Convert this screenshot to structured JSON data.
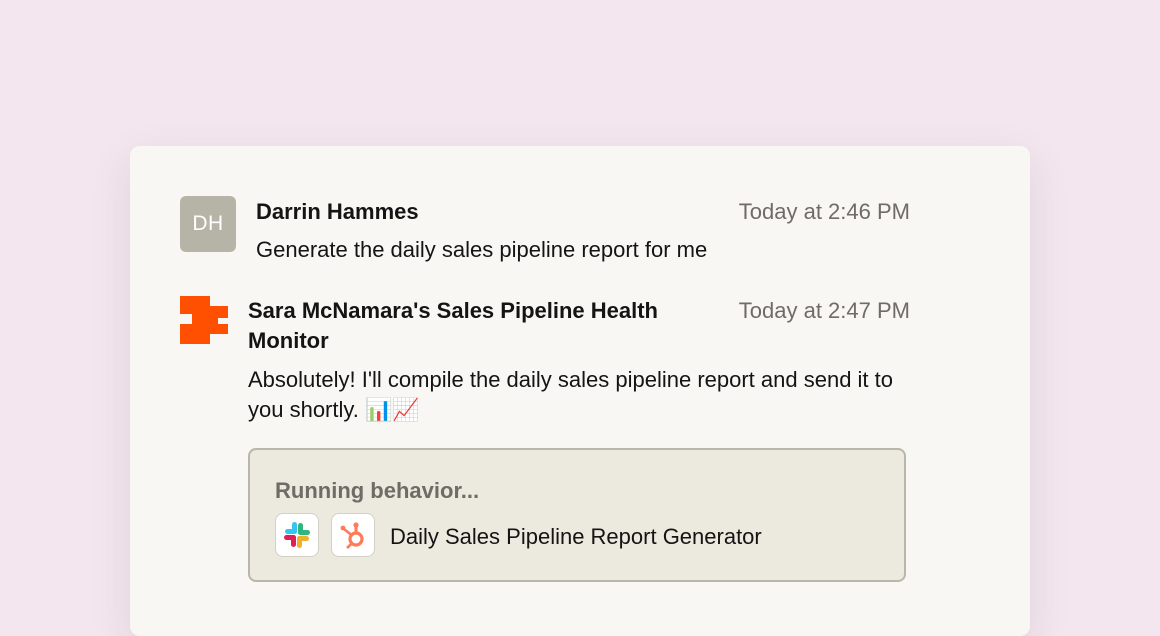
{
  "messages": [
    {
      "avatar_initials": "DH",
      "author": "Darrin Hammes",
      "timestamp": "Today at 2:46 PM",
      "text": "Generate the daily sales pipeline report for me"
    },
    {
      "avatar_icon": "zapier-logo-icon",
      "author": "Sara McNamara's Sales Pipeline Health Monitor",
      "timestamp": "Today at 2:47 PM",
      "text": "Absolutely! I'll compile the daily sales pipeline report and send it to you shortly. 📊📈",
      "behavior": {
        "status": "Running behavior...",
        "apps": [
          "slack-icon",
          "hubspot-icon"
        ],
        "name": "Daily Sales Pipeline Report Generator"
      }
    }
  ],
  "colors": {
    "page_background": "#f3e6ee",
    "card_background": "#f8f7f4",
    "avatar_background": "#b6b3a7",
    "brand_orange": "#ff4f00",
    "behavior_background": "#ece9de",
    "behavior_border": "#b9b6ab",
    "muted_text": "#6f6b66",
    "body_text": "#141414"
  }
}
